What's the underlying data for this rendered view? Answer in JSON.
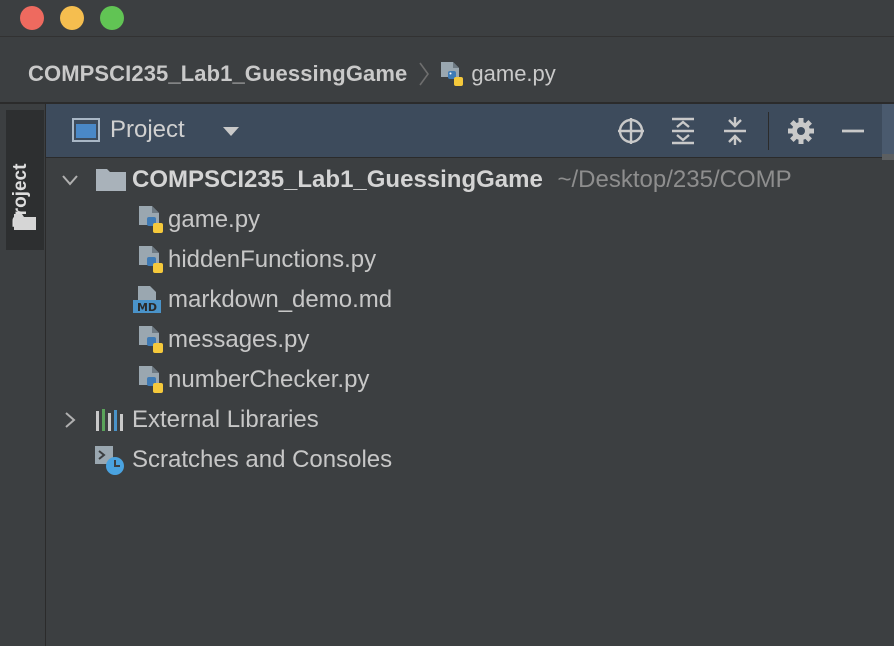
{
  "window": {
    "controls": [
      "close",
      "minimize",
      "zoom"
    ]
  },
  "breadcrumb": {
    "project": "COMPSCI235_Lab1_GuessingGame",
    "file": "game.py"
  },
  "tool_stripe": {
    "tab_label": "Project"
  },
  "project_panel": {
    "title": "Project",
    "toolbar_icons": [
      "locate-icon",
      "expand-all-icon",
      "collapse-all-icon",
      "gear-icon",
      "minimize-icon"
    ]
  },
  "tree": {
    "root": {
      "name": "COMPSCI235_Lab1_GuessingGame",
      "path": "~/Desktop/235/COMP",
      "expanded": true
    },
    "files": [
      {
        "name": "game.py",
        "icon": "python-file-icon"
      },
      {
        "name": "hiddenFunctions.py",
        "icon": "python-file-icon"
      },
      {
        "name": "markdown_demo.md",
        "icon": "markdown-file-icon"
      },
      {
        "name": "messages.py",
        "icon": "python-file-icon"
      },
      {
        "name": "numberChecker.py",
        "icon": "python-file-icon"
      }
    ],
    "external_libraries": "External Libraries",
    "scratches": "Scratches and Consoles"
  },
  "colors": {
    "background": "#3c3f41",
    "header": "#3d4b5c",
    "text": "#c7c7c7",
    "path": "#8e8e8e",
    "python_blue": "#3f7bb5",
    "python_yellow": "#f5c93b",
    "markdown_blue": "#4a93c9"
  }
}
